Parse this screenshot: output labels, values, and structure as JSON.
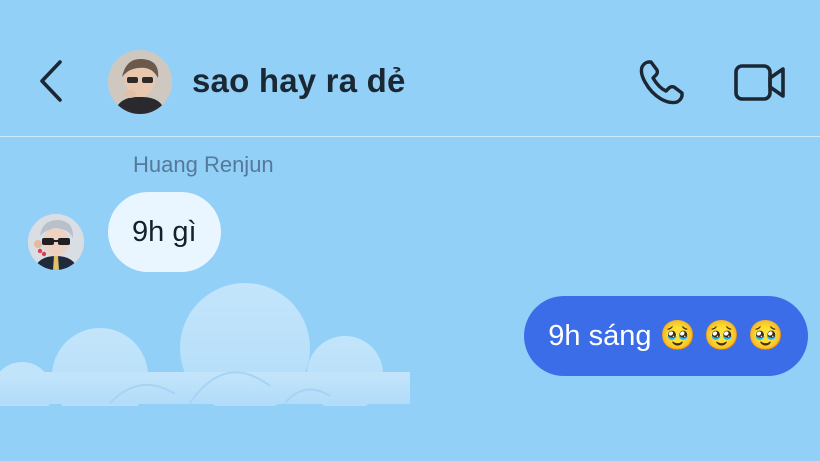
{
  "header": {
    "back_icon": "chevron-left-icon",
    "title": "sao hay ra dẻ",
    "call_icon": "phone-icon",
    "video_icon": "video-camera-icon"
  },
  "messages": [
    {
      "direction": "incoming",
      "sender": "Huang Renjun",
      "text": "9h gì"
    },
    {
      "direction": "outgoing",
      "text": "9h sáng 🥹 🥹 🥹"
    }
  ],
  "theme": {
    "background": "#93d0f7",
    "incoming_bubble": "#eaf6ff",
    "outgoing_bubble": "#3b6de8",
    "icon_color": "#1b2733"
  }
}
